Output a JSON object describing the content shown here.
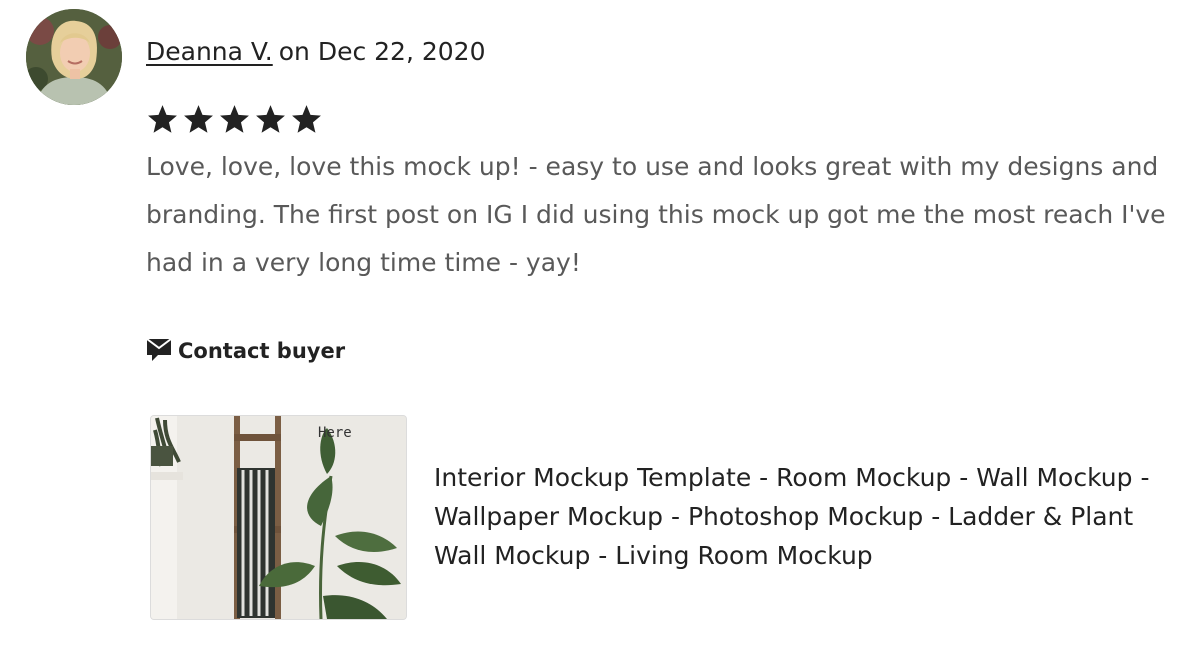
{
  "review": {
    "reviewer_name": "Deanna V.",
    "date_prefix": "on",
    "date": "Dec 22, 2020",
    "rating": 5,
    "max_rating": 5,
    "text": "Love, love, love this mock up! - easy to use and looks great with my designs and branding. The first post on IG I did using this mock up got me the most reach I've had in a very long time time - yay!"
  },
  "actions": {
    "contact_label": "Contact buyer",
    "contact_icon": "message-icon"
  },
  "listing": {
    "title": "Interior Mockup Template - Room Mockup - Wall Mockup - Wallpaper Mockup - Photoshop Mockup - Ladder & Plant Wall Mockup - Living Room Mockup",
    "thumbnail_text": "Here"
  }
}
